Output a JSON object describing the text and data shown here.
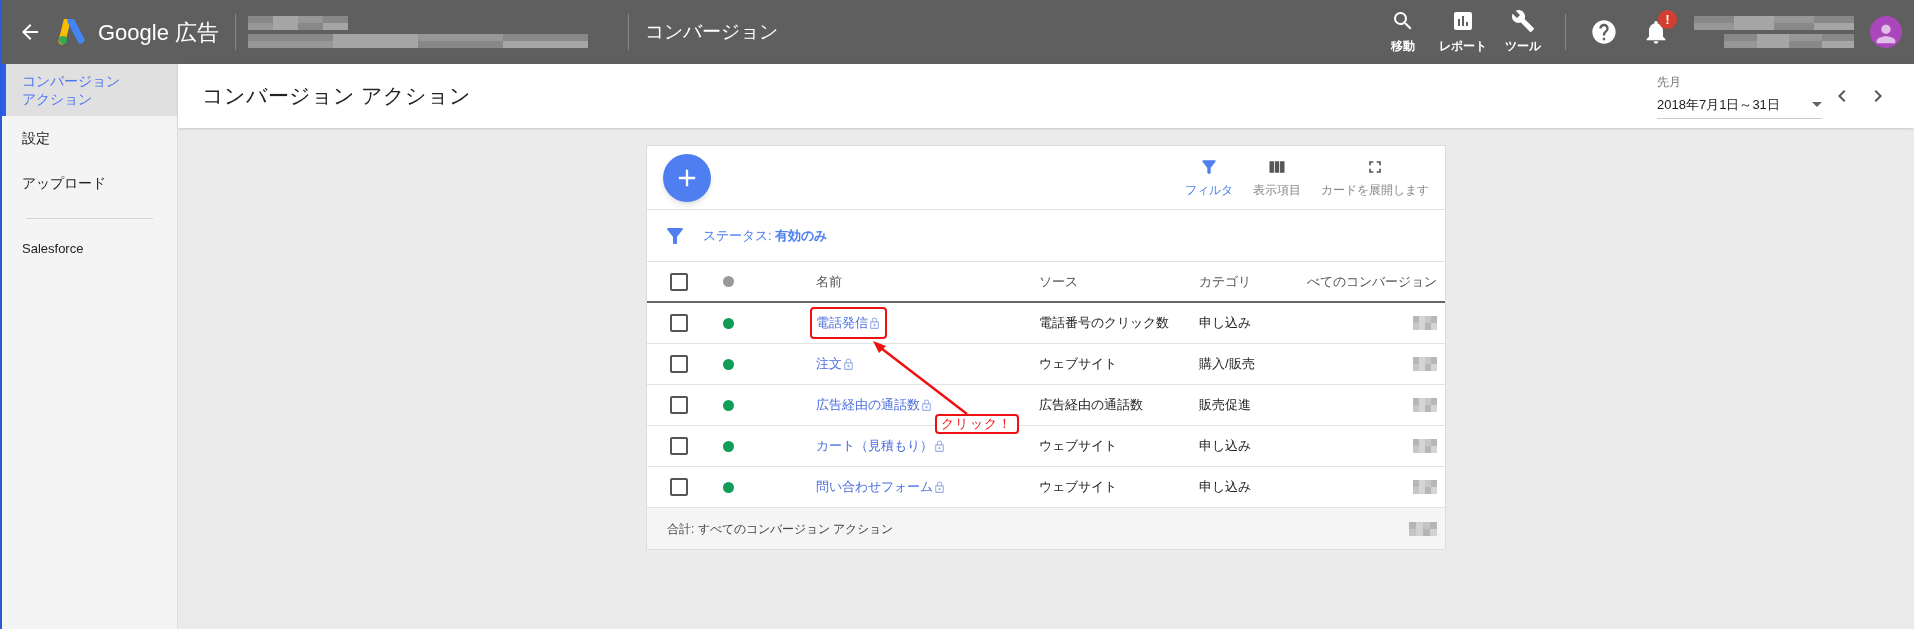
{
  "header": {
    "logo_text": "Google 広告",
    "page_title": "コンバージョン",
    "tools": [
      {
        "kind": "search",
        "label": "移動"
      },
      {
        "kind": "report",
        "label": "レポート"
      },
      {
        "kind": "tools",
        "label": "ツール"
      }
    ],
    "notification_badge": "!"
  },
  "sidebar": {
    "items": [
      {
        "label": "コンバージョンアクション",
        "selected": true
      },
      {
        "label": "設定",
        "selected": false
      },
      {
        "label": "アップロード",
        "selected": false
      }
    ],
    "extra_items": [
      {
        "label": "Salesforce",
        "selected": false
      }
    ]
  },
  "page_title": "コンバージョン アクション",
  "date_range": {
    "preset": "先月",
    "value": "2018年7月1日～31日"
  },
  "card": {
    "toolbar": [
      {
        "kind": "filter",
        "label": "フィルタ",
        "active": true
      },
      {
        "kind": "columns",
        "label": "表示項目",
        "active": false
      },
      {
        "kind": "expand",
        "label": "カードを展開します",
        "active": false
      }
    ],
    "select_all_checked": false,
    "filter_chip": "ステータス: **有効のみ**",
    "columns": [
      "名前",
      "ソース",
      "カテゴリ",
      "べてのコンバージョン"
    ],
    "rows": [
      {
        "name": "電話発信",
        "locked": true,
        "source": "電話番号のクリック数",
        "category": "申し込み",
        "color": "#0f9d58",
        "checked": false,
        "highlighted": true
      },
      {
        "name": "注文",
        "locked": true,
        "source": "ウェブサイト",
        "category": "購入/販売",
        "color": "#0f9d58",
        "checked": false,
        "highlighted": false
      },
      {
        "name": "広告経由の通話数",
        "locked": true,
        "source": "広告経由の通話数",
        "category": "販売促進",
        "color": "#0f9d58",
        "checked": false,
        "highlighted": false
      },
      {
        "name": "カート（見積もり）",
        "locked": true,
        "source": "ウェブサイト",
        "category": "申し込み",
        "color": "#0f9d58",
        "checked": false,
        "highlighted": false
      },
      {
        "name": "問い合わせフォーム",
        "locked": true,
        "source": "ウェブサイト",
        "category": "申し込み",
        "color": "#0f9d58",
        "checked": false,
        "highlighted": false
      }
    ],
    "footer": "合計: すべてのコンバージョン アクション"
  },
  "annotation": {
    "text": "クリック！"
  }
}
